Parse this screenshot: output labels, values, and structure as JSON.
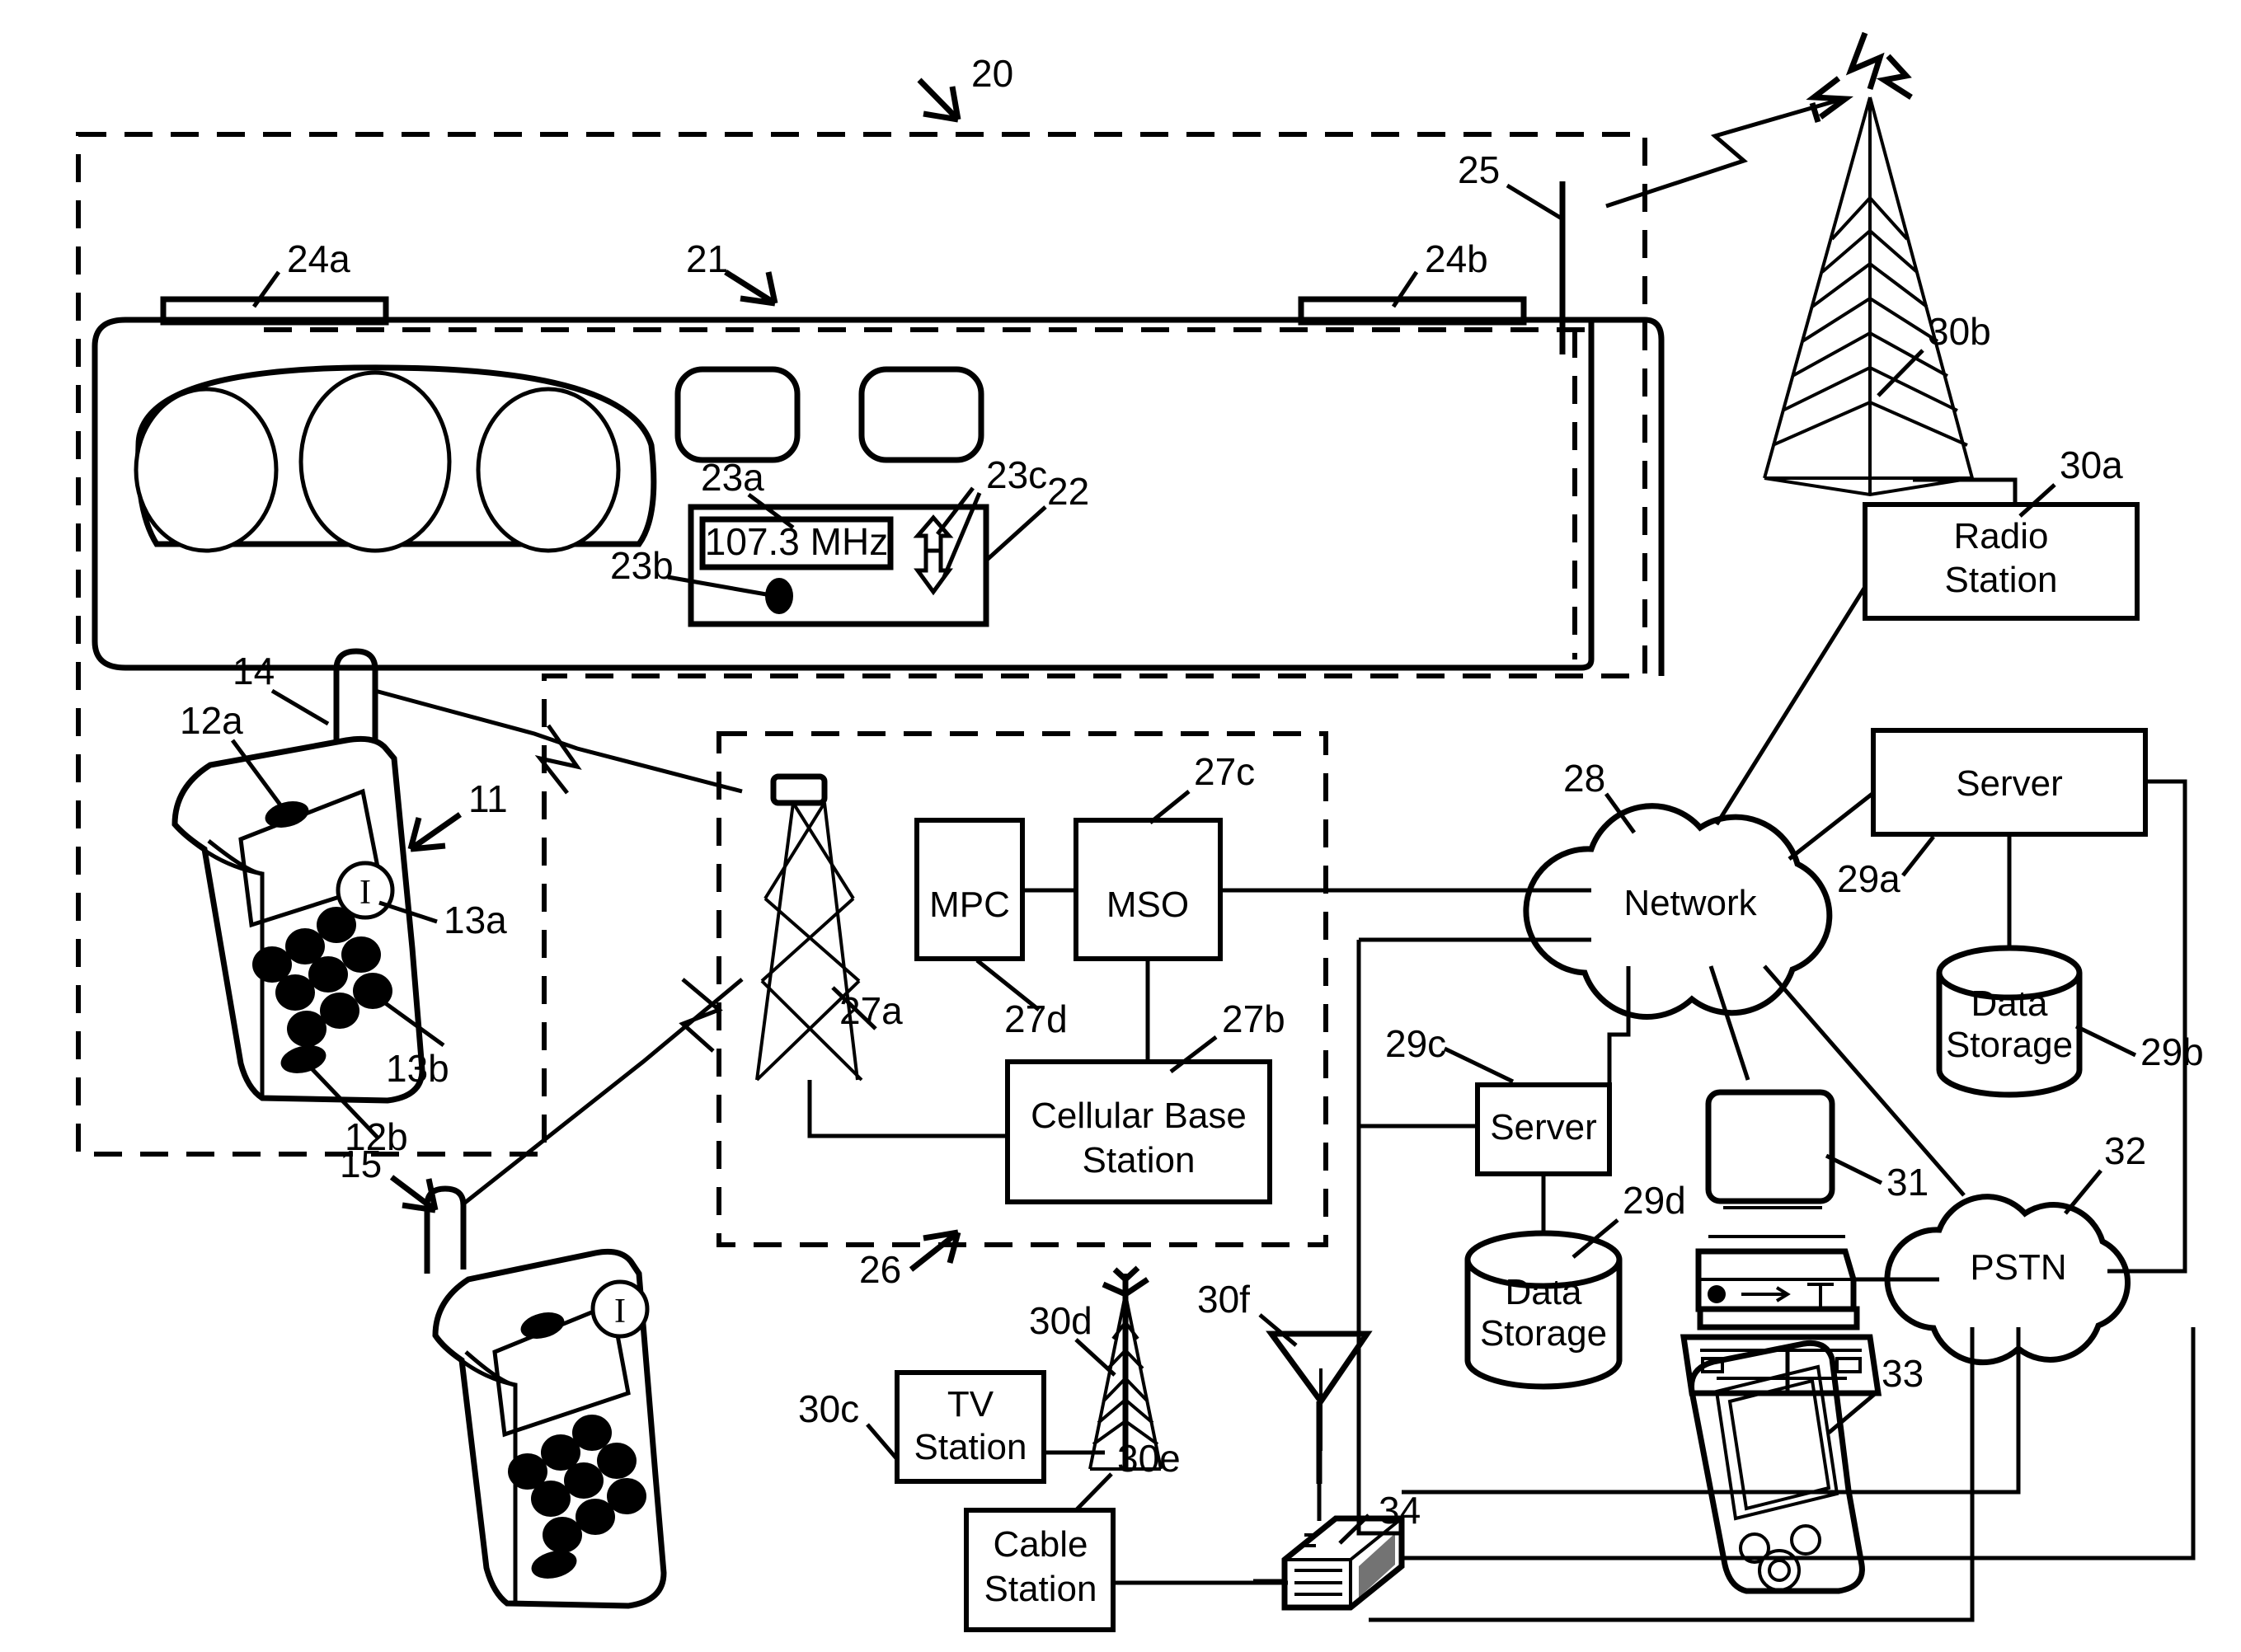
{
  "figure": {
    "type": "patent-diagram",
    "description": "Telematics / broadcast system block diagram"
  },
  "reference_numerals": {
    "n20": "20",
    "n21": "21",
    "n22": "22",
    "n23a": "23a",
    "n23b": "23b",
    "n23c": "23c",
    "n24a": "24a",
    "n24b": "24b",
    "n25": "25",
    "n26": "26",
    "n27a": "27a",
    "n27b": "27b",
    "n27c": "27c",
    "n27d": "27d",
    "n28": "28",
    "n29a": "29a",
    "n29b": "29b",
    "n29c": "29c",
    "n29d": "29d",
    "n30a": "30a",
    "n30b": "30b",
    "n30c": "30c",
    "n30d": "30d",
    "n30e": "30e",
    "n30f": "30f",
    "n31": "31",
    "n32": "32",
    "n33": "33",
    "n34": "34",
    "n11": "11",
    "n12a": "12a",
    "n12b": "12b",
    "n13a": "13a",
    "n13b": "13b",
    "n14": "14",
    "n15": "15"
  },
  "vehicle": {
    "radio": {
      "display_value": "107.3 MHz",
      "display_ref": "23a",
      "knob_ref": "23b",
      "arrows_ref": "23c",
      "unit_ref": "22"
    },
    "speakers": {
      "left_ref": "24a",
      "right_ref": "24b"
    },
    "antenna_ref": "25",
    "dashboard_ref": "21",
    "system_ref": "20",
    "gauge_count": 3,
    "vent_count": 2
  },
  "handsets": [
    {
      "ref": "11",
      "antenna_ref": "14",
      "speaker_ref": "12a",
      "button_label": "I",
      "button_ref": "13a",
      "keypad_ref": "13b"
    },
    {
      "ref": "15",
      "button_label": "I"
    }
  ],
  "blocks": [
    {
      "id": "mpc",
      "label": "MPC",
      "ref": "27d"
    },
    {
      "id": "mso",
      "label": "MSO",
      "ref": "27c"
    },
    {
      "id": "cell_base",
      "label": "Cellular Base Station",
      "ref": "27b"
    },
    {
      "id": "radio_station",
      "label": "Radio Station",
      "ref": "30a"
    },
    {
      "id": "server_right",
      "label": "Server",
      "ref": "29a"
    },
    {
      "id": "server_mid",
      "label": "Server",
      "ref": "29c"
    },
    {
      "id": "tv_station",
      "label": "TV Station",
      "ref": "30c"
    },
    {
      "id": "cable_station",
      "label": "Cable Station",
      "ref": "30e"
    }
  ],
  "storage": [
    {
      "id": "ds_right",
      "label_line1": "Data",
      "label_line2": "Storage",
      "ref": "29b"
    },
    {
      "id": "ds_mid",
      "label_line1": "Data",
      "label_line2": "Storage",
      "ref": "29d"
    }
  ],
  "clouds": [
    {
      "id": "network",
      "label": "Network",
      "ref": "28"
    },
    {
      "id": "pstn",
      "label": "PSTN",
      "ref": "32"
    }
  ],
  "towers": [
    {
      "id": "cell_tower",
      "ref": "27a"
    },
    {
      "id": "radio_tower",
      "ref": "30b"
    },
    {
      "id": "tv_tower",
      "ref": "30d"
    }
  ],
  "misc_devices": [
    {
      "id": "dish_antenna",
      "ref": "30f"
    },
    {
      "id": "desktop_computer",
      "ref": "31"
    },
    {
      "id": "pda",
      "ref": "33"
    },
    {
      "id": "set_top_box",
      "ref": "34"
    }
  ],
  "colors": {
    "ink": "#000000",
    "paper": "#ffffff"
  }
}
